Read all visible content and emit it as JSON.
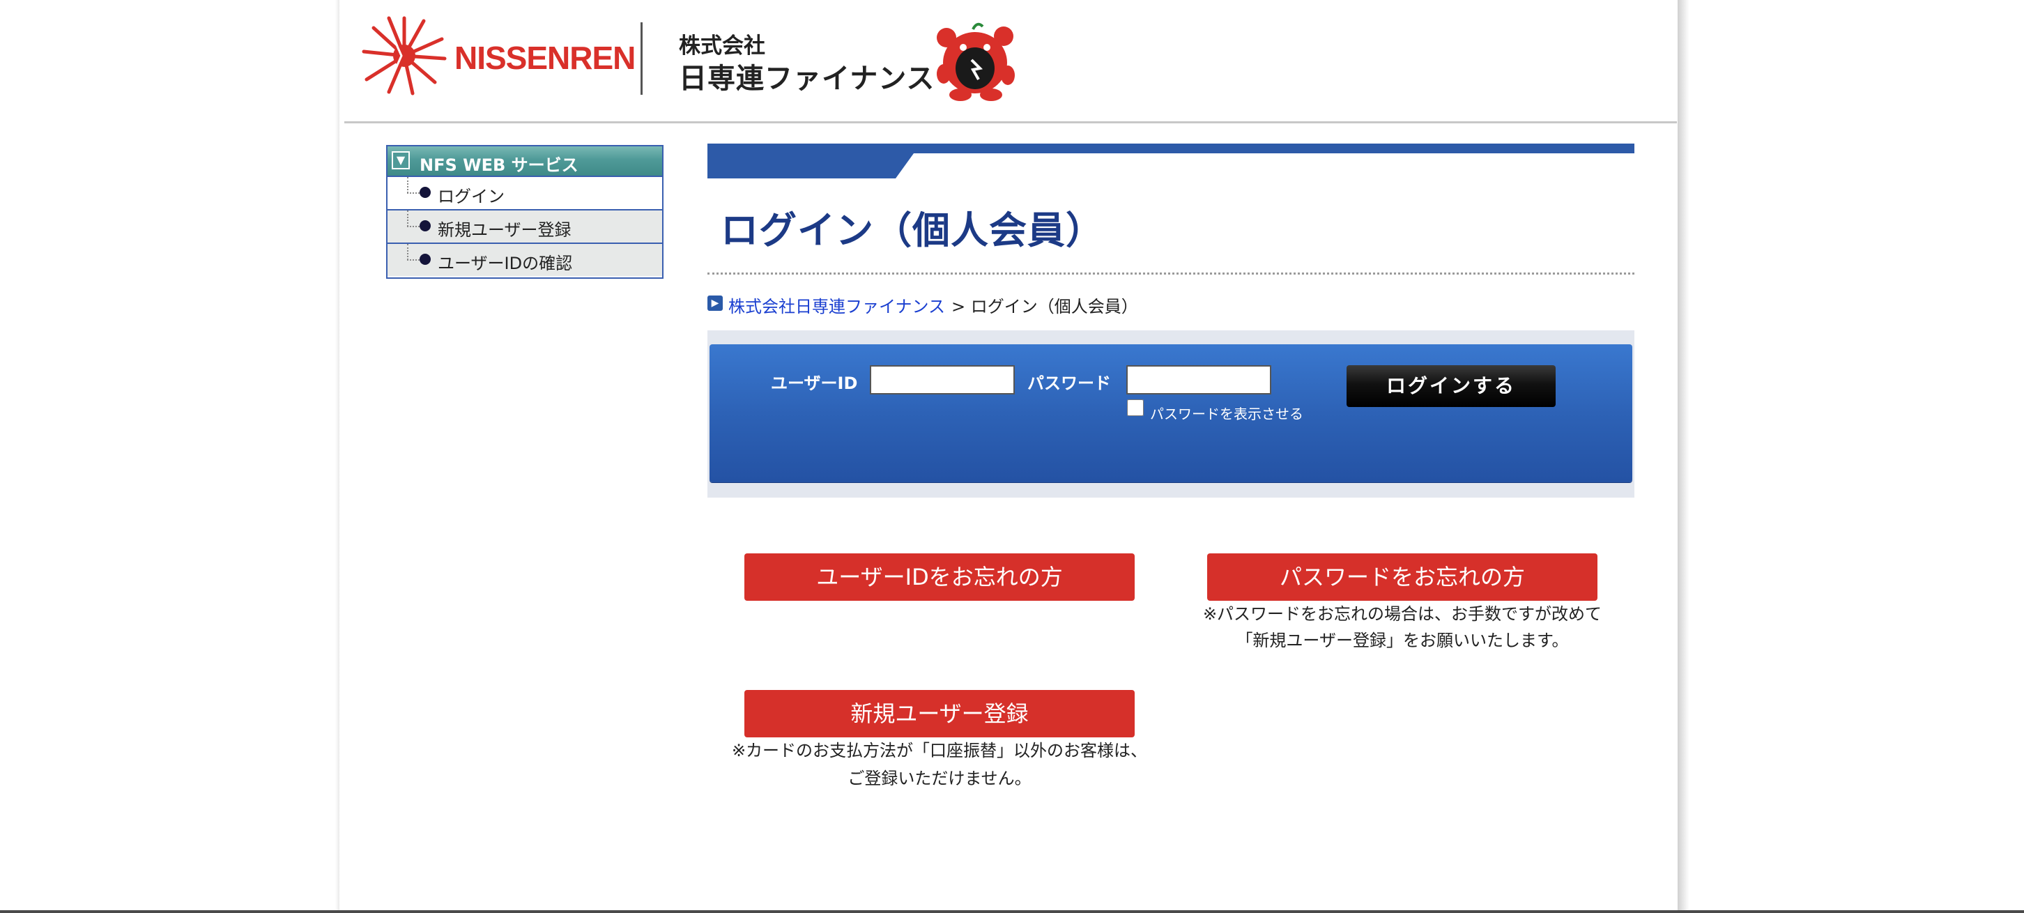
{
  "header": {
    "logo_text": "NISSENREN",
    "company_small": "株式会社",
    "company_name": "日専連ファイナンス"
  },
  "sidebar": {
    "title": "NFS WEB サービス",
    "items": [
      {
        "label": "ログイン"
      },
      {
        "label": "新規ユーザー登録"
      },
      {
        "label": "ユーザーIDの確認"
      }
    ]
  },
  "main": {
    "title": "ログイン（個人会員）",
    "breadcrumb": {
      "link": "株式会社日専連ファイナンス",
      "current": "> ログイン（個人会員）"
    }
  },
  "login": {
    "user_id_label": "ユーザーID",
    "user_id_value": "",
    "password_label": "パスワード",
    "password_value": "",
    "show_password_label": "パスワードを表示させる",
    "show_password_checked": false,
    "submit_label": "ログインする"
  },
  "actions": {
    "forgot_id": "ユーザーIDをお忘れの方",
    "forgot_password": "パスワードをお忘れの方",
    "forgot_password_note_1": "※パスワードをお忘れの場合は、お手数ですが改めて",
    "forgot_password_note_2": "「新規ユーザー登録」をお願いいたします。",
    "register": "新規ユーザー登録",
    "register_note_1": "※カードのお支払方法が「口座振替」以外のお客様は、",
    "register_note_2": "ご登録いただけません。"
  },
  "colors": {
    "brand_red": "#d6302a",
    "title_blue": "#1c3a86",
    "panel_blue": "#2d62b6",
    "sidebar_teal": "#4f9a98"
  }
}
